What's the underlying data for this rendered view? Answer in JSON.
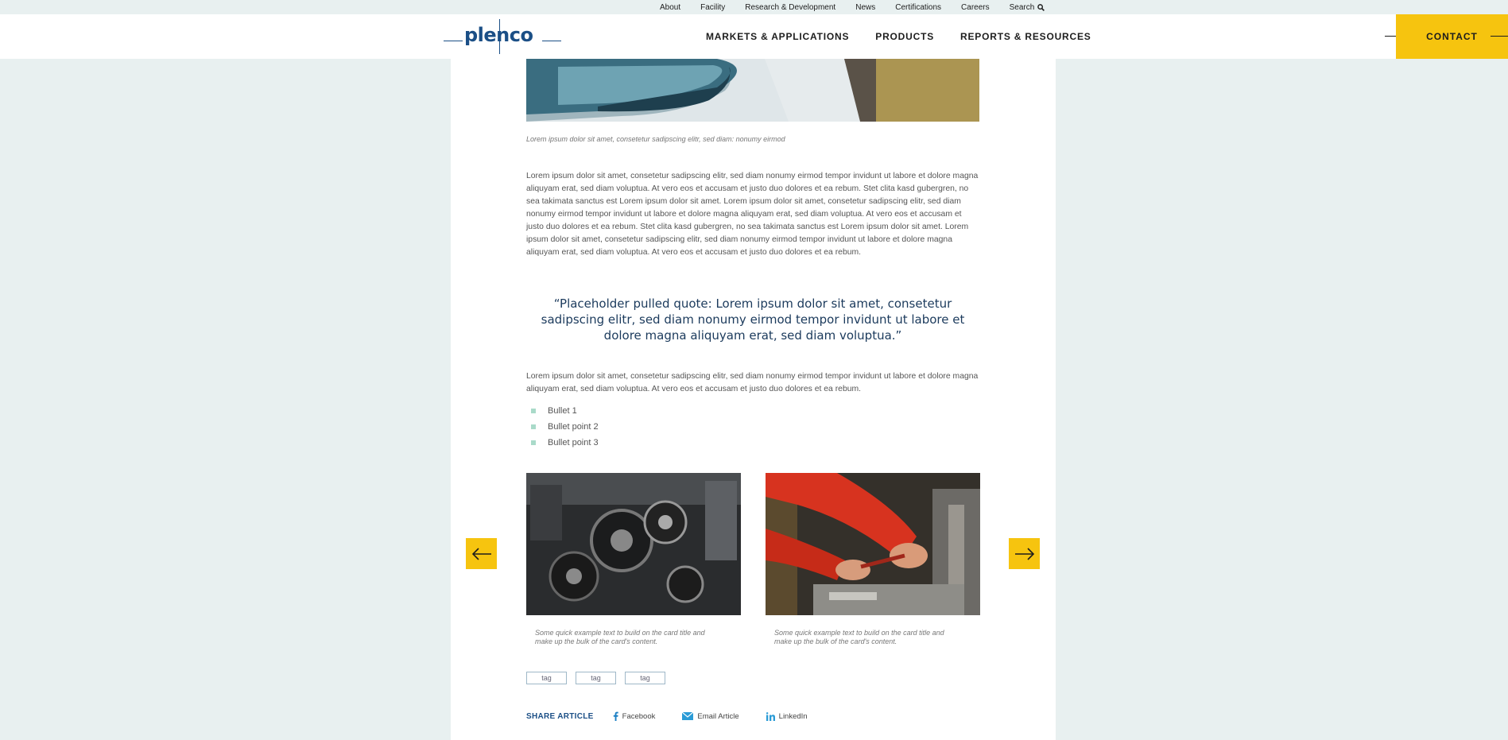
{
  "utility_nav": {
    "items": [
      "About",
      "Facility",
      "Research & Development",
      "News",
      "Certifications",
      "Careers"
    ],
    "search_label": "Search"
  },
  "brand": {
    "logo_text": "plenco"
  },
  "main_nav": {
    "items": [
      "MARKETS & APPLICATIONS",
      "PRODUCTS",
      "REPORTS & RESOURCES"
    ],
    "contact_label": "CONTACT"
  },
  "article": {
    "hero_caption": "Lorem ipsum dolor sit amet, consetetur sadipscing elitr, sed diam: nonumy eirmod",
    "paragraph_1": "Lorem ipsum dolor sit amet, consetetur sadipscing elitr, sed diam nonumy eirmod tempor invidunt ut labore et dolore magna aliquyam erat, sed diam voluptua. At vero eos et accusam et justo duo dolores et ea rebum. Stet clita kasd gubergren, no sea takimata sanctus est Lorem ipsum dolor sit amet. Lorem ipsum dolor sit amet, consetetur sadipscing elitr, sed diam nonumy eirmod tempor invidunt ut labore et dolore magna aliquyam erat, sed diam voluptua. At vero eos et accusam et justo duo dolores et ea rebum. Stet clita kasd gubergren, no sea takimata sanctus est Lorem ipsum dolor sit amet. Lorem ipsum dolor sit amet, consetetur sadipscing elitr, sed diam nonumy eirmod tempor invidunt ut labore et dolore magna aliquyam erat, sed diam voluptua. At vero eos et accusam et justo duo dolores et ea rebum.",
    "pull_quote": "“Placeholder pulled quote: Lorem ipsum dolor sit amet, consetetur sadipscing elitr, sed diam nonumy eirmod tempor invidunt ut labore et dolore magna aliquyam erat, sed diam voluptua.”",
    "paragraph_2": "Lorem ipsum dolor sit amet, consetetur sadipscing elitr, sed diam nonumy eirmod tempor invidunt ut labore et dolore magna aliquyam erat, sed diam voluptua. At vero eos et accusam et justo duo dolores et ea rebum.",
    "bullets": [
      "Bullet 1",
      "Bullet point 2",
      "Bullet point 3"
    ],
    "cards": [
      {
        "image": "engine-belt-photo",
        "caption": "Some quick example text to build on the card title and make up the bulk of the card's content."
      },
      {
        "image": "worker-machining-photo",
        "caption": "Some quick example text to build on the card title and make up the bulk of the card's content."
      }
    ],
    "tags": [
      "tag",
      "tag",
      "tag"
    ],
    "share": {
      "label": "SHARE ARTICLE",
      "links": [
        "Facebook",
        "Email Article",
        "LinkedIn"
      ]
    }
  },
  "colors": {
    "background": "#e8f0f0",
    "accent_yellow": "#f6c40f",
    "brand_blue": "#1b4f86",
    "bullet_mint": "#a9dac9"
  },
  "icons": [
    "search-icon",
    "arrow-left-icon",
    "arrow-right-icon",
    "facebook-icon",
    "email-icon",
    "linkedin-icon"
  ]
}
